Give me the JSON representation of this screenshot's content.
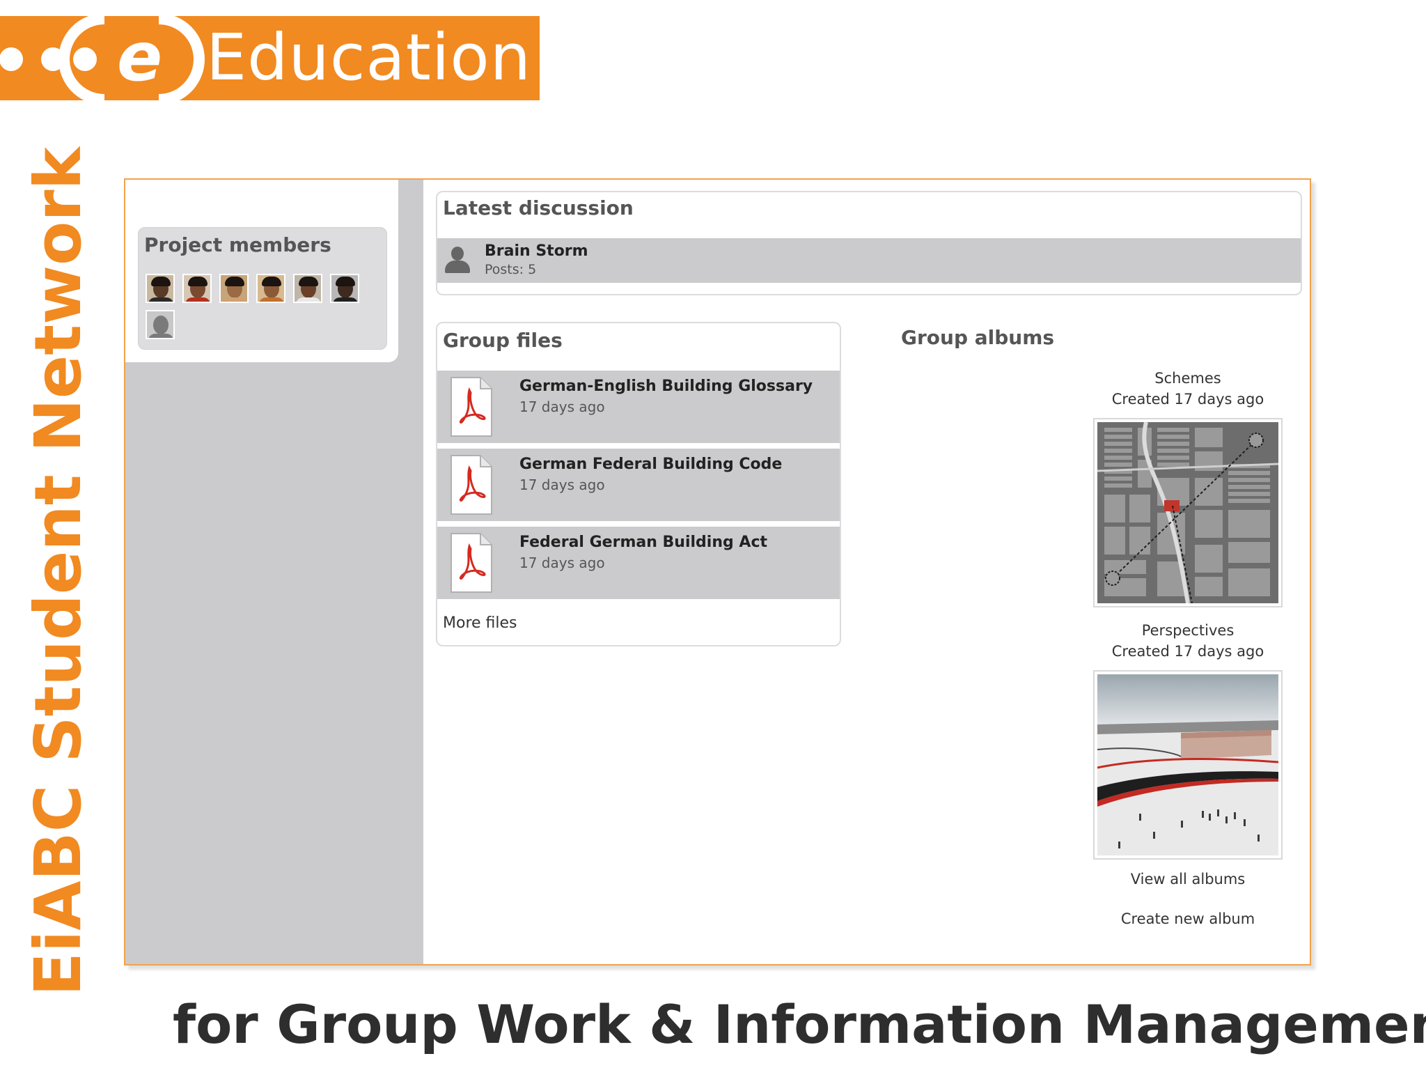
{
  "brand": {
    "title": "Education",
    "logo_letter": "e",
    "color": "#f18a21"
  },
  "side_title": "EiABC Student Network",
  "tagline": "for Group Work & Information Management",
  "project_members": {
    "title": "Project members",
    "avatars": [
      {
        "icon": "member-avatar-1",
        "skin": "#5a3a26",
        "shirt": "#2a2a2a"
      },
      {
        "icon": "member-avatar-2",
        "skin": "#7a4a30",
        "shirt": "#b33020"
      },
      {
        "icon": "member-avatar-3",
        "skin": "#9a6a44",
        "shirt": "#d0a070"
      },
      {
        "icon": "member-avatar-4",
        "skin": "#8a5a38",
        "shirt": "#c07030"
      },
      {
        "icon": "member-avatar-5",
        "skin": "#6a4028",
        "shirt": "#e8e8e8"
      },
      {
        "icon": "member-avatar-6",
        "skin": "#3e2a1e",
        "shirt": "#202020"
      },
      {
        "icon": "default-avatar-icon",
        "placeholder": true
      }
    ]
  },
  "latest_discussion": {
    "title": "Latest discussion",
    "topic": "Brain Storm",
    "posts": "Posts: 5"
  },
  "group_files": {
    "title": "Group files",
    "files": [
      {
        "name": "German-English Building Glossary",
        "date": "17 days ago",
        "icon": "pdf-icon"
      },
      {
        "name": "German Federal Building Code",
        "date": "17 days ago",
        "icon": "pdf-icon"
      },
      {
        "name": "Federal German Building Act",
        "date": "17 days ago",
        "icon": "pdf-icon"
      }
    ],
    "more_label": "More files"
  },
  "group_albums": {
    "title": "Group albums",
    "albums": [
      {
        "name": "Schemes",
        "created": "Created 17 days ago"
      },
      {
        "name": "Perspectives",
        "created": "Created 17 days ago"
      }
    ],
    "view_all_label": "View all albums",
    "create_label": "Create new album"
  },
  "colors": {
    "accent": "#f18a21",
    "sidebar": "#cbcbcd",
    "row": "#cbcbcd"
  }
}
